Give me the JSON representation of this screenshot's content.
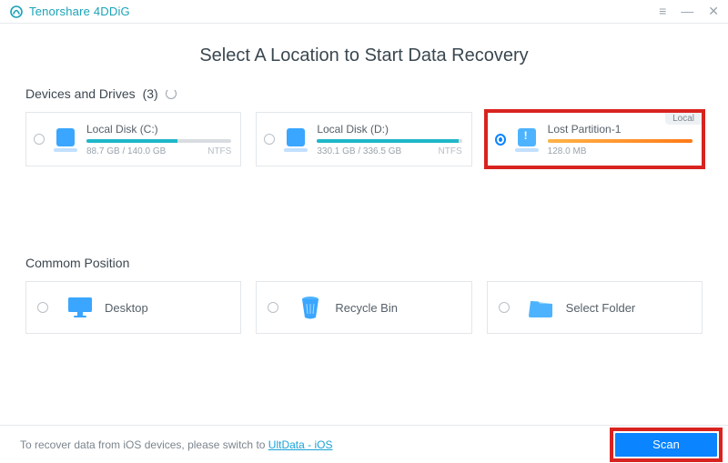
{
  "app": {
    "name": "Tenorshare 4DDiG"
  },
  "page": {
    "title": "Select A Location to Start Data Recovery"
  },
  "drives_section": {
    "heading": "Devices and Drives",
    "count": "(3)"
  },
  "drives": [
    {
      "name": "Local Disk (C:)",
      "usage": "88.7 GB / 140.0 GB",
      "fs": "NTFS",
      "fill_pct": 63,
      "selected": false,
      "color": "teal"
    },
    {
      "name": "Local Disk (D:)",
      "usage": "330.1 GB / 336.5 GB",
      "fs": "NTFS",
      "fill_pct": 98,
      "selected": false,
      "color": "teal"
    },
    {
      "name": "Lost Partition-1",
      "usage": "128.0 MB",
      "fs": "",
      "fill_pct": 100,
      "selected": true,
      "color": "orange",
      "tag": "Local"
    }
  ],
  "common_section": {
    "heading": "Commom Position"
  },
  "commons": [
    {
      "label": "Desktop",
      "icon": "monitor"
    },
    {
      "label": "Recycle Bin",
      "icon": "trash"
    },
    {
      "label": "Select Folder",
      "icon": "folder"
    }
  ],
  "footer": {
    "prefix": "To recover data from iOS devices, please switch to ",
    "link": "UltData - iOS",
    "scan": "Scan"
  }
}
